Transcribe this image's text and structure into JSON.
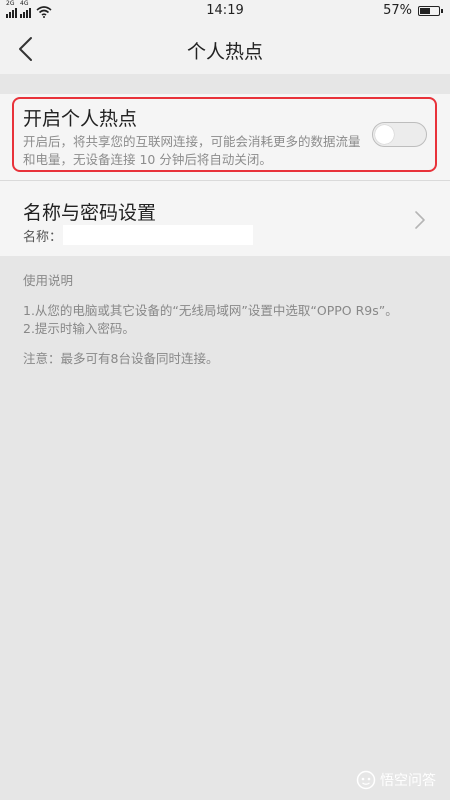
{
  "status_bar": {
    "sim1_tag": "2G",
    "sim2_tag": "4G",
    "time": "14:19",
    "battery_percent": "57%",
    "battery_level": 0.57
  },
  "header": {
    "title": "个人热点"
  },
  "hotspot": {
    "title": "开启个人热点",
    "description": "开启后，将共享您的互联网连接，可能会消耗更多的数据流量和电量，无设备连接 10 分钟后将自动关闭。",
    "enabled": false
  },
  "name_password": {
    "title": "名称与密码设置",
    "name_label": "名称："
  },
  "instructions": {
    "title": "使用说明",
    "step1": "1.从您的电脑或其它设备的“无线局域网”设置中选取“OPPO R9s”。",
    "step2": "2.提示时输入密码。",
    "note": "注意：最多可有8台设备同时连接。"
  },
  "watermark": {
    "text": "悟空问答"
  },
  "colors": {
    "highlight": "#e8323a",
    "background": "#e6e6e6",
    "card": "#f5f5f5"
  }
}
